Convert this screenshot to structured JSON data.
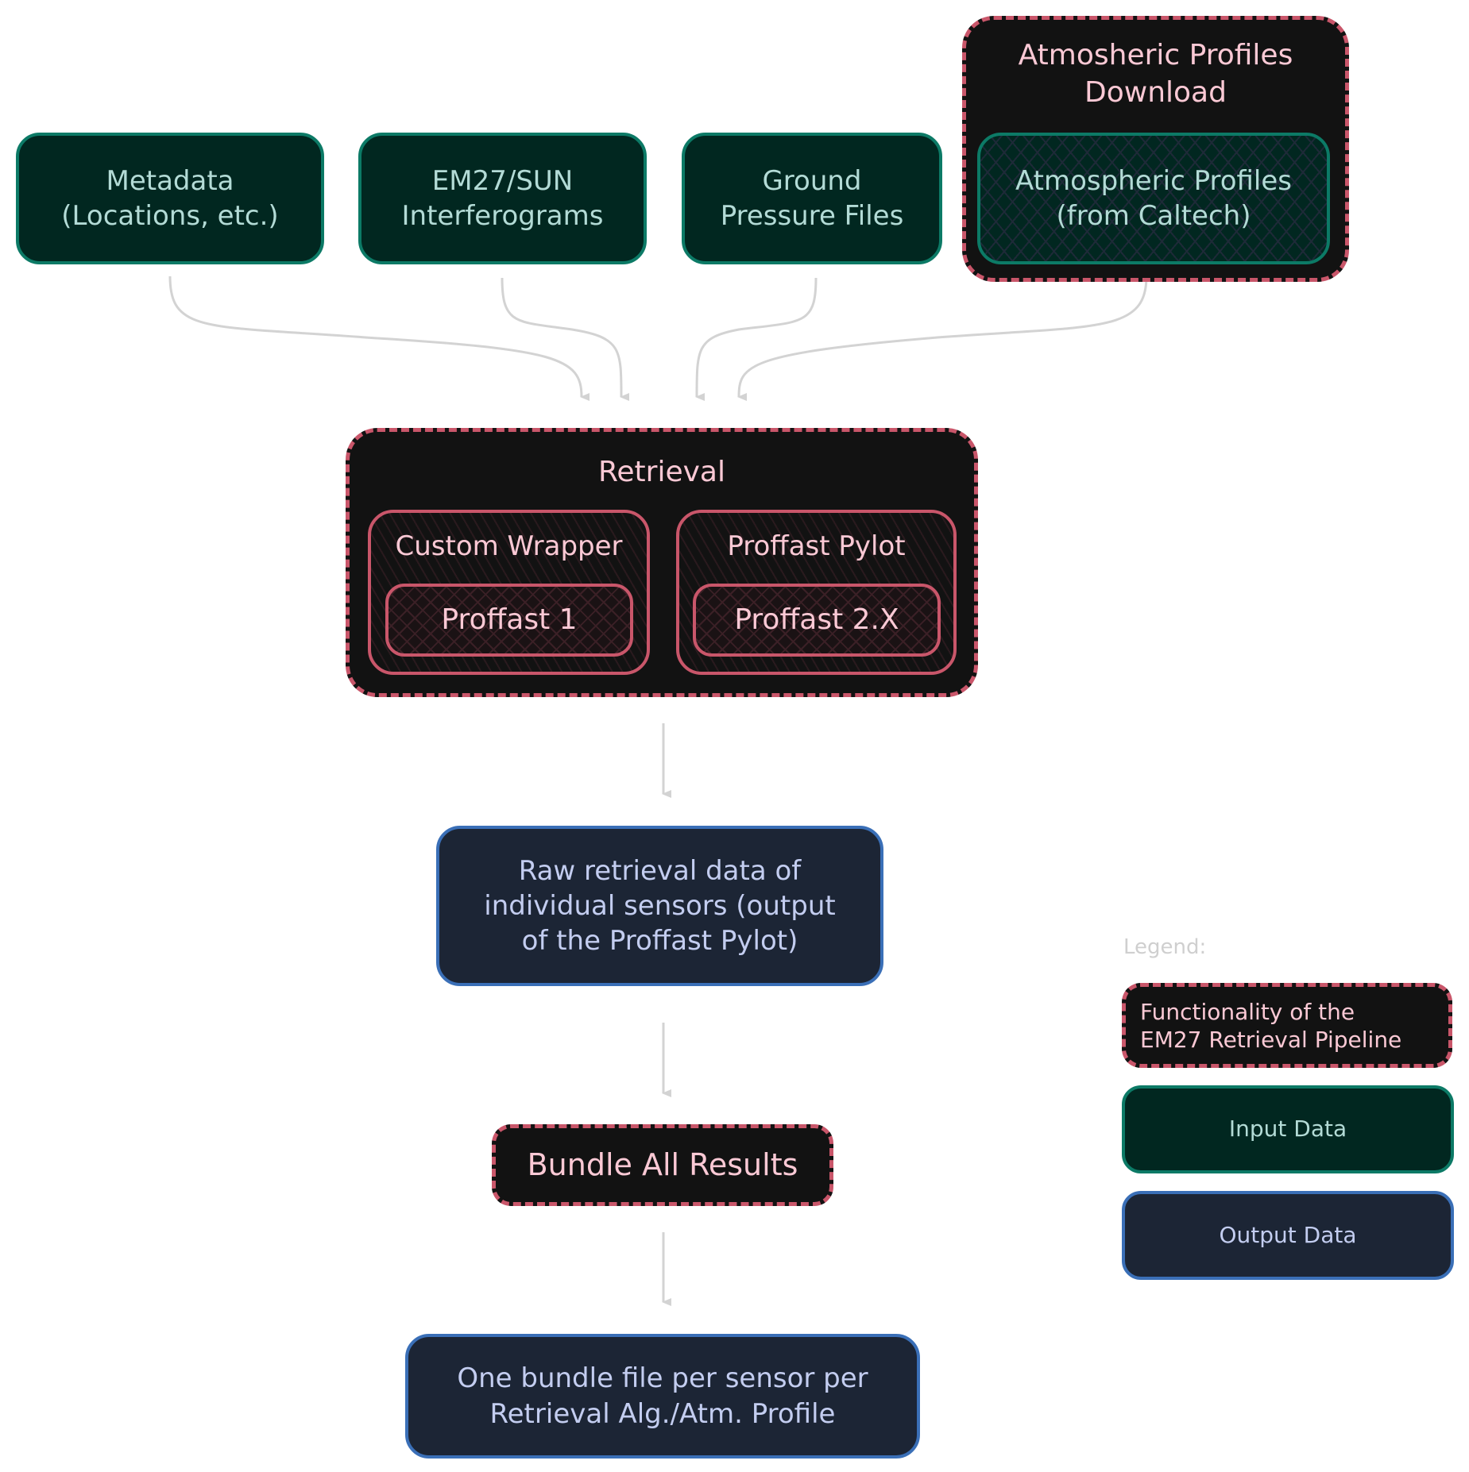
{
  "inputs": {
    "metadata": "Metadata\n(Locations, etc.)",
    "interferograms": "EM27/SUN\nInterferograms",
    "ground_pressure": "Ground\nPressure Files",
    "atm_download_title": "Atmosheric Profiles\nDownload",
    "atm_profiles": "Atmospheric Profiles\n(from Caltech)"
  },
  "retrieval": {
    "title": "Retrieval",
    "custom_wrapper": "Custom Wrapper",
    "proffast1": "Proffast 1",
    "proffast_pylot": "Proffast Pylot",
    "proffast2": "Proffast 2.X"
  },
  "outputs": {
    "raw": "Raw retrieval data of\nindividual sensors (output\nof the Proffast Pylot)",
    "bundle_step": "Bundle All Results",
    "bundle_file": "One bundle file per sensor per\nRetrieval Alg./Atm. Profile"
  },
  "legend": {
    "label": "Legend:",
    "functionality": "Functionality of the\nEM27 Retrieval Pipeline",
    "input": "Input Data",
    "output": "Output Data"
  },
  "colors": {
    "input_fill": "#012720",
    "input_stroke": "#0c7a66",
    "func_fill": "#121212",
    "func_stroke": "#c9566a",
    "output_fill": "#1c2535",
    "output_stroke": "#3a6fb7",
    "arrow": "#d3d3d3"
  }
}
